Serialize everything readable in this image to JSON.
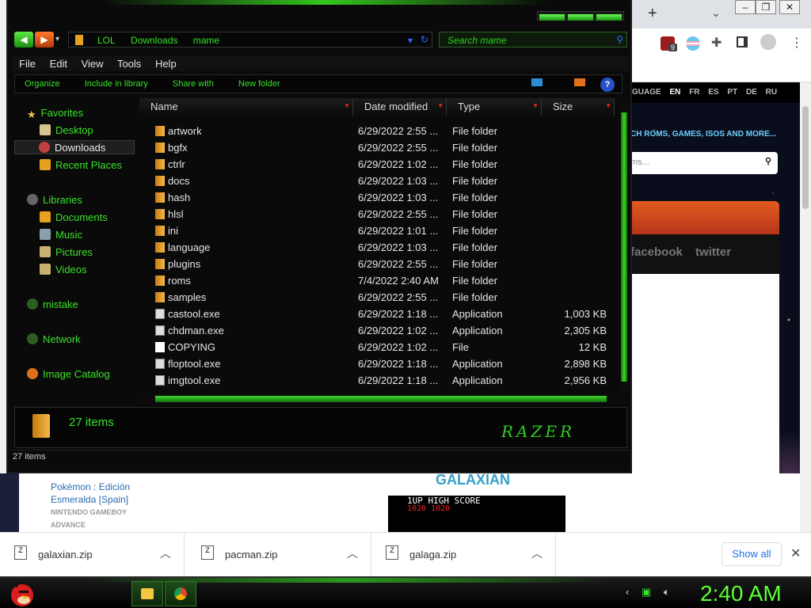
{
  "explorer": {
    "breadcrumb": [
      "LOL",
      "Downloads",
      "mame"
    ],
    "search_placeholder": "Search mame",
    "menu": [
      "File",
      "Edit",
      "View",
      "Tools",
      "Help"
    ],
    "commands": [
      "Organize",
      "Include in library",
      "Share with",
      "New folder"
    ],
    "nav": {
      "favorites": "Favorites",
      "desktop": "Desktop",
      "downloads": "Downloads",
      "recent": "Recent Places",
      "libraries": "Libraries",
      "documents": "Documents",
      "music": "Music",
      "pictures": "Pictures",
      "videos": "Videos",
      "mistake": "mistake",
      "network": "Network",
      "image_catalog": "Image Catalog"
    },
    "columns": [
      "Name",
      "Date modified",
      "Type",
      "Size"
    ],
    "files": [
      {
        "name": "artwork",
        "date": "6/29/2022 2:55 ...",
        "type": "File folder",
        "size": "",
        "kind": "folder"
      },
      {
        "name": "bgfx",
        "date": "6/29/2022 2:55 ...",
        "type": "File folder",
        "size": "",
        "kind": "folder"
      },
      {
        "name": "ctrlr",
        "date": "6/29/2022 1:02 ...",
        "type": "File folder",
        "size": "",
        "kind": "folder"
      },
      {
        "name": "docs",
        "date": "6/29/2022 1:03 ...",
        "type": "File folder",
        "size": "",
        "kind": "folder"
      },
      {
        "name": "hash",
        "date": "6/29/2022 1:03 ...",
        "type": "File folder",
        "size": "",
        "kind": "folder"
      },
      {
        "name": "hlsl",
        "date": "6/29/2022 2:55 ...",
        "type": "File folder",
        "size": "",
        "kind": "folder"
      },
      {
        "name": "ini",
        "date": "6/29/2022 1:01 ...",
        "type": "File folder",
        "size": "",
        "kind": "folder"
      },
      {
        "name": "language",
        "date": "6/29/2022 1:03 ...",
        "type": "File folder",
        "size": "",
        "kind": "folder"
      },
      {
        "name": "plugins",
        "date": "6/29/2022 2:55 ...",
        "type": "File folder",
        "size": "",
        "kind": "folder"
      },
      {
        "name": "roms",
        "date": "7/4/2022 2:40 AM",
        "type": "File folder",
        "size": "",
        "kind": "folder"
      },
      {
        "name": "samples",
        "date": "6/29/2022 2:55 ...",
        "type": "File folder",
        "size": "",
        "kind": "folder"
      },
      {
        "name": "castool.exe",
        "date": "6/29/2022 1:18 ...",
        "type": "Application",
        "size": "1,003 KB",
        "kind": "exe"
      },
      {
        "name": "chdman.exe",
        "date": "6/29/2022 1:02 ...",
        "type": "Application",
        "size": "2,305 KB",
        "kind": "exe"
      },
      {
        "name": "COPYING",
        "date": "6/29/2022 1:02 ...",
        "type": "File",
        "size": "12 KB",
        "kind": "file"
      },
      {
        "name": "floptool.exe",
        "date": "6/29/2022 1:18 ...",
        "type": "Application",
        "size": "2,898 KB",
        "kind": "exe"
      },
      {
        "name": "imgtool.exe",
        "date": "6/29/2022 1:18 ...",
        "type": "Application",
        "size": "2,956 KB",
        "kind": "exe"
      }
    ],
    "item_count": "27 items",
    "status": "27 items",
    "logo_text": "RAZER"
  },
  "browser": {
    "badge_count": "9",
    "lang_label": "GUAGE",
    "languages": [
      "EN",
      "FR",
      "ES",
      "PT",
      "DE",
      "RU"
    ],
    "tagline": "CH ROMS, GAMES, ISOS AND MORE...",
    "search_placeholder": "ms...",
    "social": [
      "facebook",
      "twitter"
    ],
    "game_title": "GALAXIAN",
    "hud_labels": "1UP    HIGH SCORE",
    "hud_scores": "1020     1020",
    "related_title_1": "Pokémon : Edición",
    "related_title_2": "Esmeralda [Spain]",
    "related_platform_1": "NINTENDO GAMEBOY",
    "related_platform_2": "ADVANCE"
  },
  "downloads": [
    "galaxian.zip",
    "pacman.zip",
    "galaga.zip"
  ],
  "show_all": "Show all",
  "clock": "2:40 AM",
  "colors": {
    "accent": "#38e228",
    "folder": "#e8a020",
    "chrome_bg": "#dee1e6"
  }
}
